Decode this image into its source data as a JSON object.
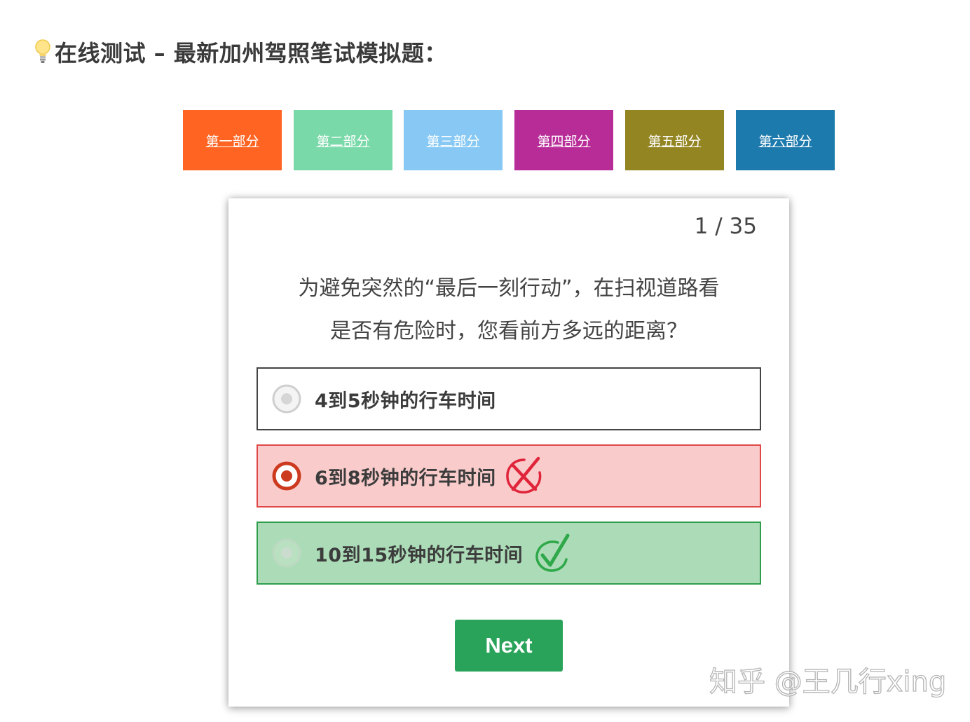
{
  "page": {
    "title": "在线测试 – 最新加州驾照笔试模拟题："
  },
  "tabs": [
    {
      "label": "第一部分",
      "color": "#ff6422"
    },
    {
      "label": "第二部分",
      "color": "#7ad9a9"
    },
    {
      "label": "第三部分",
      "color": "#87c9f4"
    },
    {
      "label": "第四部分",
      "color": "#b82c98"
    },
    {
      "label": "第五部分",
      "color": "#938522"
    },
    {
      "label": "第六部分",
      "color": "#1d7aad"
    }
  ],
  "quiz": {
    "progress": "1 / 35",
    "question_line1": "为避免突然的“最后一刻行动”，在扫视道路看",
    "question_line2": "是否有危险时，您看前方多远的距离？",
    "options": [
      {
        "label": "4到5秒钟的行车时间",
        "state": "unselected",
        "background": "#ffffff",
        "radio_icon": "radio-unselected-icon"
      },
      {
        "label": "6到8秒钟的行车时间",
        "state": "selected-wrong",
        "background": "#f9cbcb",
        "radio_icon": "radio-selected-icon",
        "mark_icon": "cross-icon",
        "mark_color": "#e0253a"
      },
      {
        "label": "10到15秒钟的行车时间",
        "state": "correct",
        "background": "#acdcb7",
        "radio_icon": "radio-unselected-icon",
        "mark_icon": "check-icon",
        "mark_color": "#2fa84a"
      }
    ],
    "next_label": "Next",
    "next_color": "#2aa35a"
  },
  "watermark": "知乎 @王几行xing"
}
